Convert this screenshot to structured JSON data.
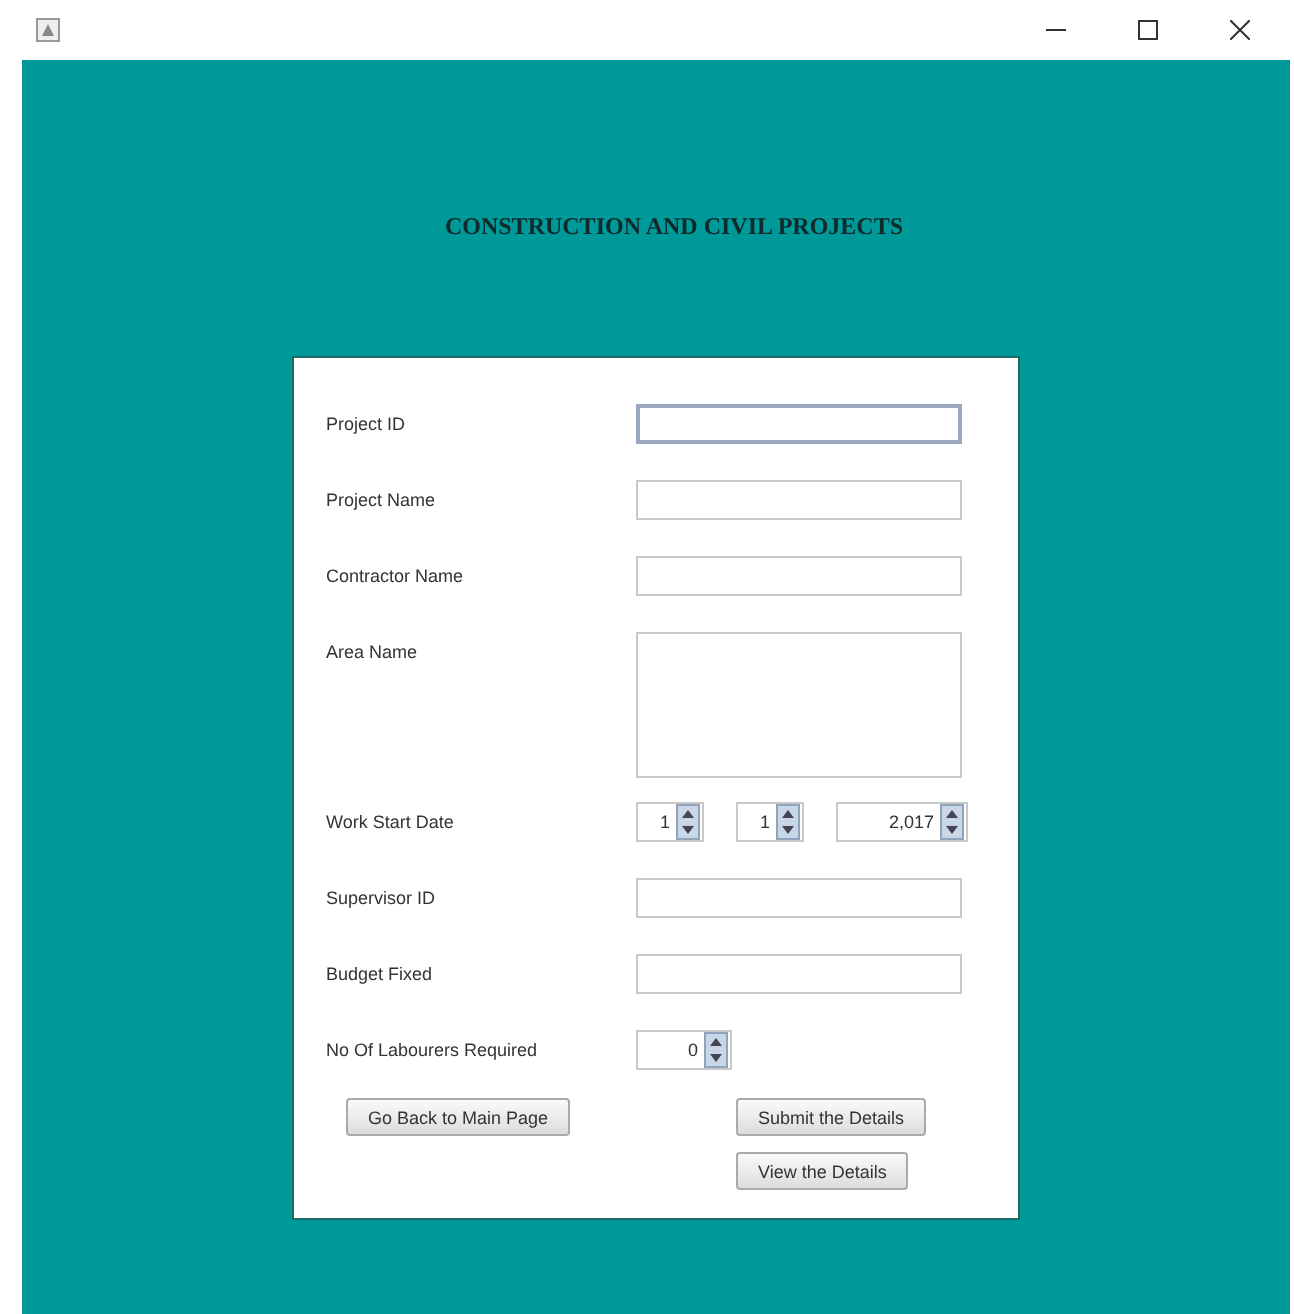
{
  "heading": "CONSTRUCTION AND CIVIL PROJECTS",
  "fields": [
    {
      "label": "Project ID",
      "kind": "text",
      "focused": true
    },
    {
      "label": "Project Name",
      "kind": "text",
      "focused": false
    },
    {
      "label": "Contractor Name",
      "kind": "text",
      "focused": false
    },
    {
      "label": "Area Name",
      "kind": "textarea",
      "focused": false
    },
    {
      "label": "Work Start Date",
      "kind": "spinners",
      "spinners": [
        {
          "value": "1"
        },
        {
          "value": "1"
        },
        {
          "value": "2,017"
        }
      ]
    },
    {
      "label": "Supervisor ID",
      "kind": "text",
      "focused": false
    },
    {
      "label": "Budget Fixed",
      "kind": "text",
      "focused": false
    },
    {
      "label": "No Of Labourers Required",
      "kind": "spinners",
      "spinners": [
        {
          "value": "0"
        }
      ]
    }
  ],
  "buttons": {
    "left": [
      {
        "label": "Go Back to Main Page"
      }
    ],
    "right": [
      {
        "label": "Submit the Details"
      },
      {
        "label": "View the Details"
      }
    ]
  }
}
